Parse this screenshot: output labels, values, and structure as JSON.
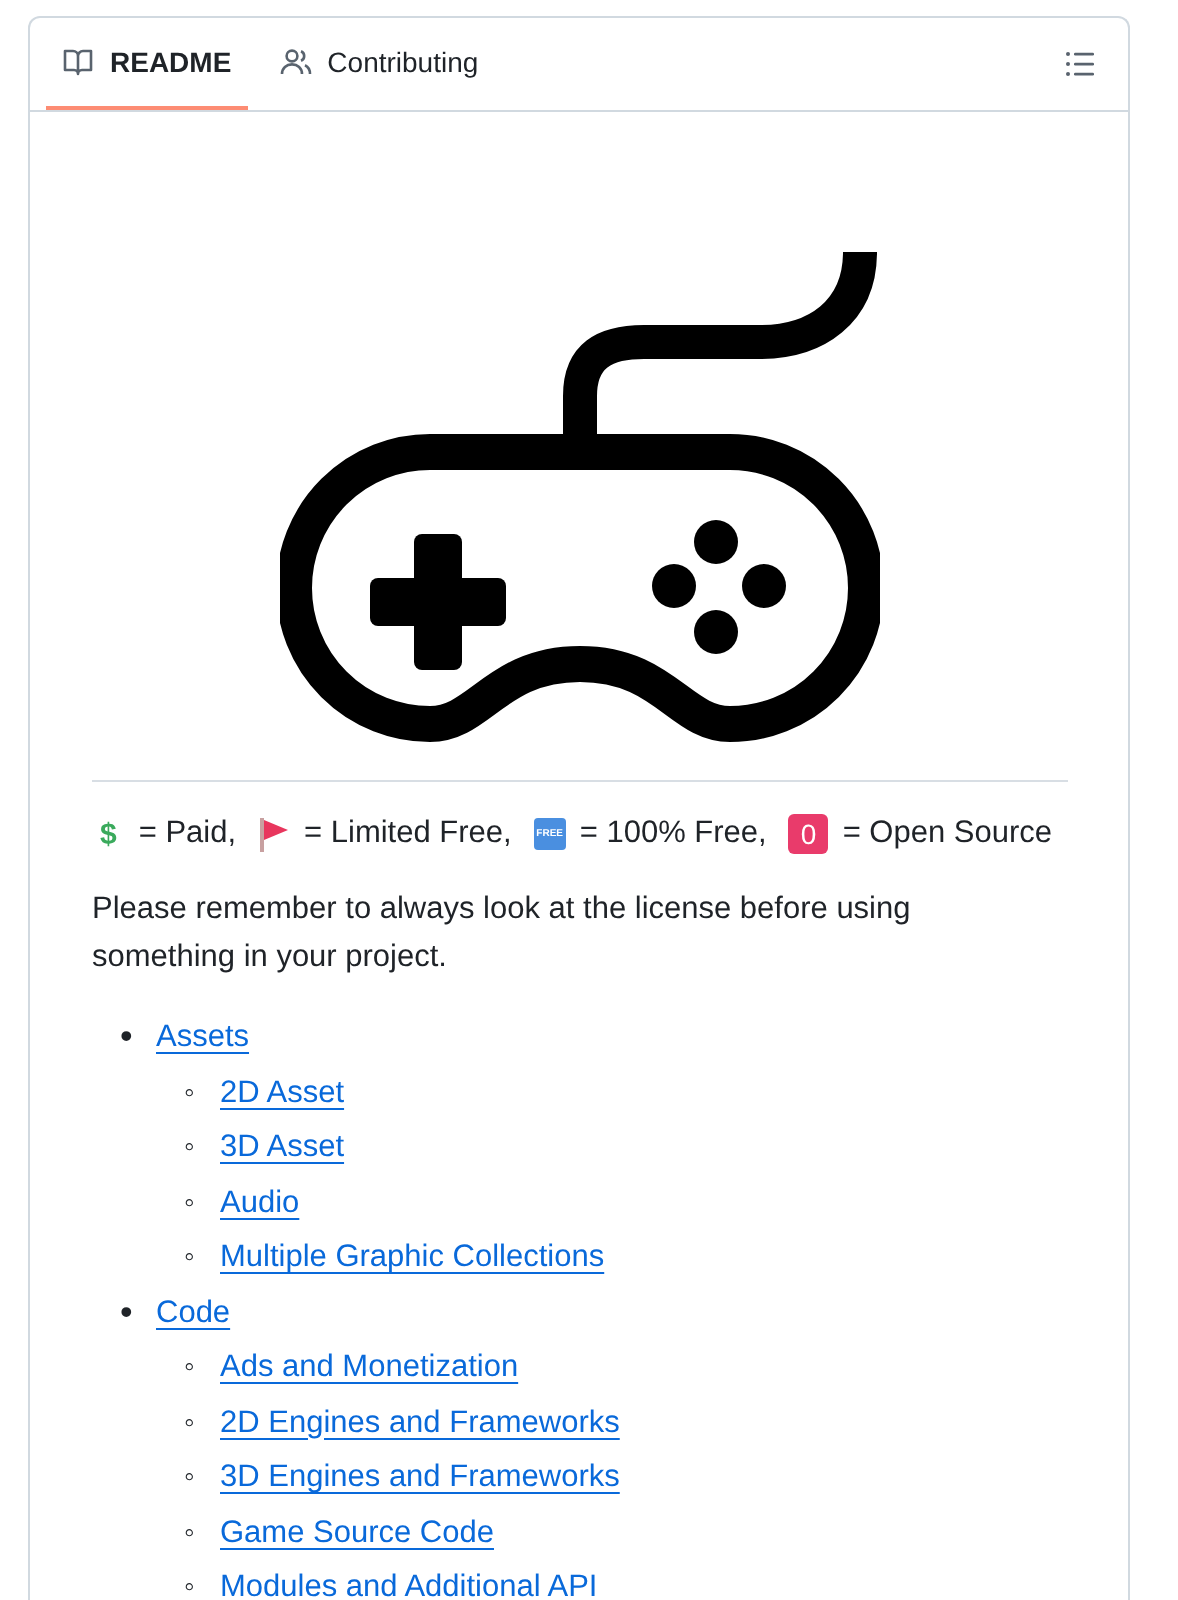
{
  "tabs": [
    {
      "label": "README",
      "kind": "book",
      "selected": true
    },
    {
      "label": "Contributing",
      "kind": "people",
      "selected": false
    }
  ],
  "legend": [
    {
      "kind": "dollar",
      "badge": "$",
      "label": "= Paid,"
    },
    {
      "kind": "flag",
      "label": "= Limited Free,"
    },
    {
      "kind": "free",
      "badge": "FREE",
      "label": "= 100% Free,"
    },
    {
      "kind": "zero",
      "badge": "0",
      "label": "= Open Source"
    }
  ],
  "intro": "Please remember to always look at the license before using something in your project.",
  "contents": [
    {
      "marker": "•",
      "label": "Assets",
      "children": [
        {
          "marker": "◦",
          "label": "2D Asset"
        },
        {
          "marker": "◦",
          "label": "3D Asset"
        },
        {
          "marker": "◦",
          "label": "Audio"
        },
        {
          "marker": "◦",
          "label": "Multiple Graphic Collections"
        }
      ]
    },
    {
      "marker": "•",
      "label": "Code",
      "children": [
        {
          "marker": "◦",
          "label": "Ads and Monetization"
        },
        {
          "marker": "◦",
          "label": "2D Engines and Frameworks"
        },
        {
          "marker": "◦",
          "label": "3D Engines and Frameworks"
        },
        {
          "marker": "◦",
          "label": "Game Source Code"
        },
        {
          "marker": "◦",
          "label": "Modules and Additional API"
        }
      ]
    }
  ]
}
